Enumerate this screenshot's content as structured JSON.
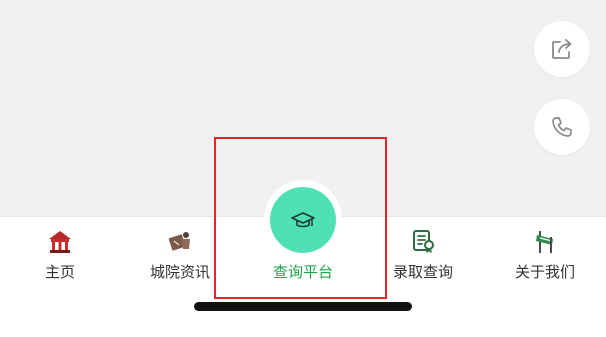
{
  "fabs": {
    "share_icon": "share-icon",
    "phone_icon": "phone-icon"
  },
  "tabbar": {
    "items": [
      {
        "label": "主页",
        "icon": "home-building-icon",
        "active": false
      },
      {
        "label": "城院资讯",
        "icon": "news-figure-icon",
        "active": false
      },
      {
        "label": "查询平台",
        "icon": "graduation-cap-icon",
        "active": true
      },
      {
        "label": "录取查询",
        "icon": "certificate-icon",
        "active": false
      },
      {
        "label": "关于我们",
        "icon": "signpost-icon",
        "active": false
      }
    ]
  },
  "colors": {
    "active_label": "#1fa54a",
    "center_button": "#4fe0b6",
    "highlight_border": "#e3242b",
    "background": "#f1f1f1"
  }
}
